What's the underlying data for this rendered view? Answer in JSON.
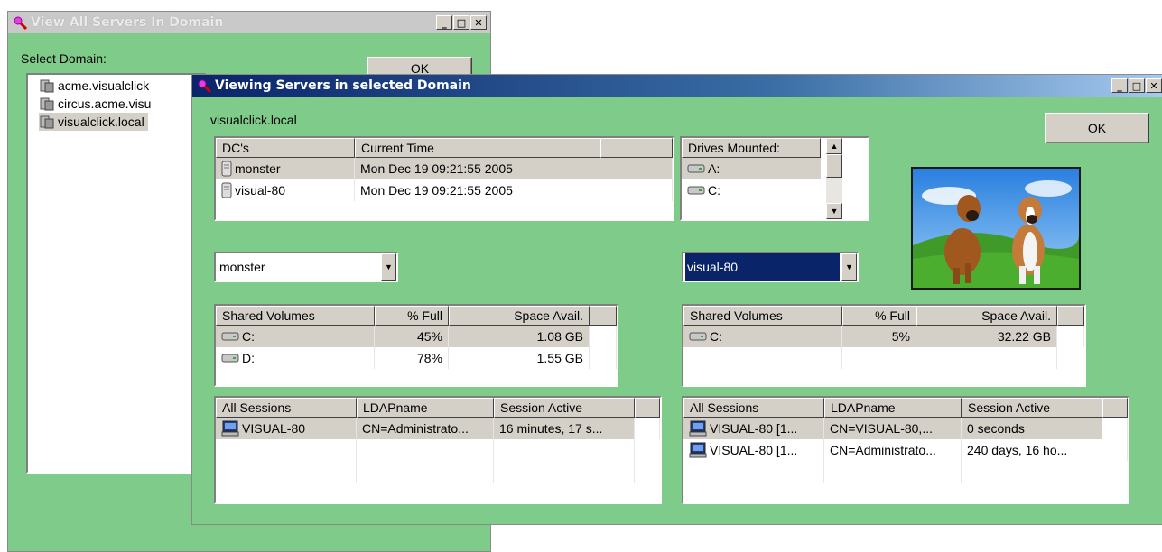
{
  "back_window": {
    "title": "View All Servers In Domain",
    "select_label": "Select Domain:",
    "ok_label": "OK",
    "domains": [
      "acme.visualclick",
      "circus.acme.visu",
      "visualclick.local"
    ]
  },
  "front_window": {
    "title": "Viewing Servers in selected Domain",
    "domain_name": "visualclick.local",
    "ok_label": "OK",
    "dc_list": {
      "headers": [
        "DC's",
        "Current Time",
        ""
      ],
      "rows": [
        {
          "name": "monster",
          "time": "Mon Dec 19 09:21:55 2005"
        },
        {
          "name": "visual-80",
          "time": "Mon Dec 19 09:21:55 2005"
        }
      ]
    },
    "drives": {
      "header": "Drives Mounted:",
      "rows": [
        "A:",
        "C:"
      ]
    },
    "left": {
      "server_select": "monster",
      "volumes": {
        "headers": [
          "Shared Volumes",
          "% Full",
          "Space Avail."
        ],
        "rows": [
          {
            "vol": "C:",
            "full": "45%",
            "avail": "1.08 GB"
          },
          {
            "vol": "D:",
            "full": "78%",
            "avail": "1.55 GB"
          }
        ]
      },
      "sessions": {
        "headers": [
          "All Sessions",
          "LDAPname",
          "Session Active"
        ],
        "rows": [
          {
            "session": "VISUAL-80",
            "ldap": "CN=Administrato...",
            "active": "16 minutes, 17 s..."
          }
        ]
      }
    },
    "right": {
      "server_select": "visual-80",
      "volumes": {
        "headers": [
          "Shared Volumes",
          "% Full",
          "Space Avail."
        ],
        "rows": [
          {
            "vol": "C:",
            "full": "5%",
            "avail": "32.22 GB"
          }
        ]
      },
      "sessions": {
        "headers": [
          "All Sessions",
          "LDAPname",
          "Session Active"
        ],
        "rows": [
          {
            "session": "VISUAL-80 [1...",
            "ldap": "CN=VISUAL-80,...",
            "active": "0 seconds"
          },
          {
            "session": "VISUAL-80 [1...",
            "ldap": "CN=Administrato...",
            "active": "240 days, 16 ho..."
          }
        ]
      }
    }
  },
  "colors": {
    "window_bg": "#7fcc8a",
    "titlebar_active": "#0a246a",
    "selection": "#0a246a"
  }
}
